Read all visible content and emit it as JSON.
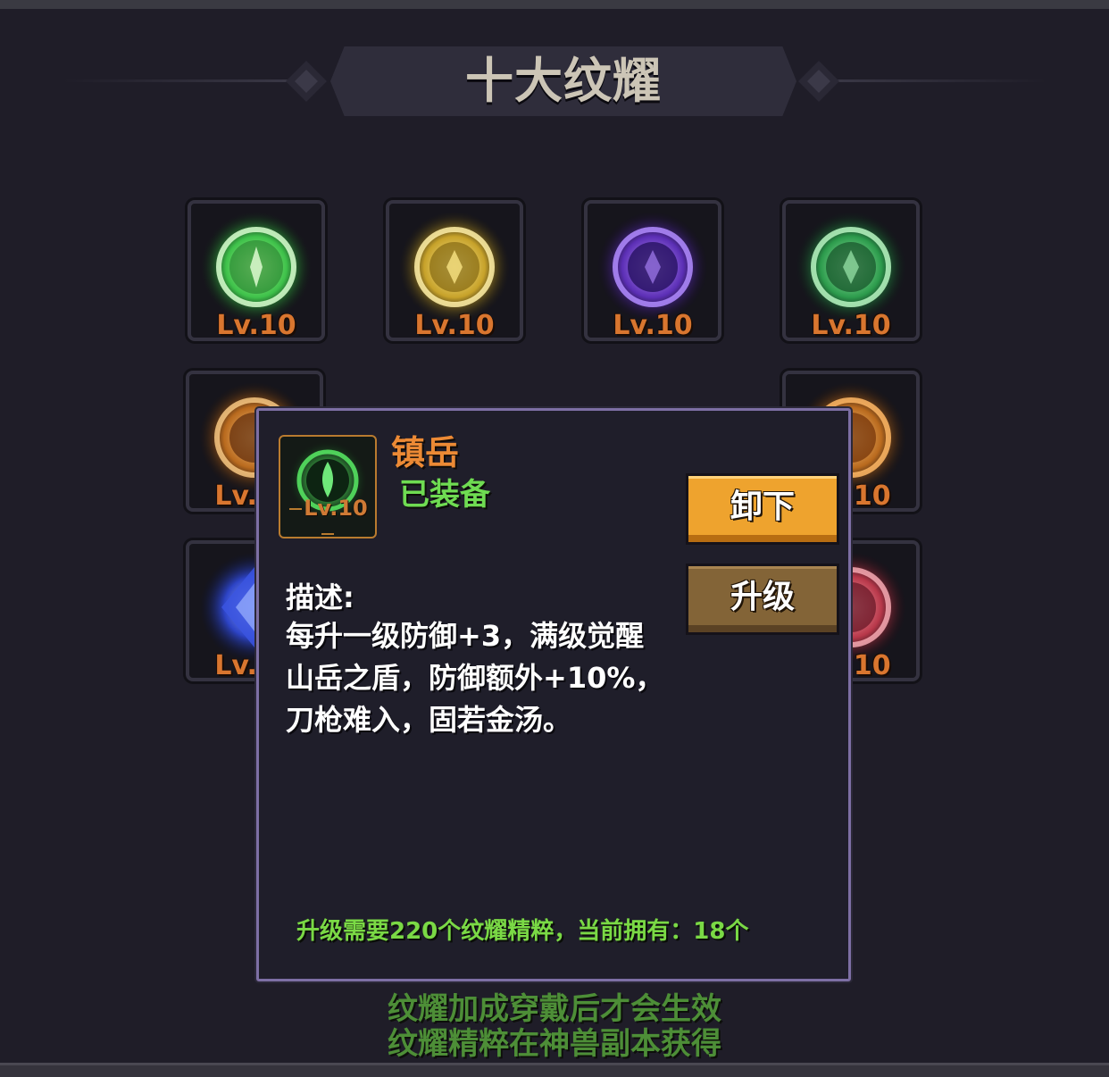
{
  "title": "十大纹耀",
  "slots": [
    {
      "level": "Lv.10",
      "icon": "green-leaf-ring-glyph-icon",
      "color": "#4fd15a"
    },
    {
      "level": "Lv.10",
      "icon": "gold-leaf-ring-glyph-icon",
      "color": "#e2c535"
    },
    {
      "level": "Lv.10",
      "icon": "purple-leaf-ring-glyph-icon",
      "color": "#7d43d8"
    },
    {
      "level": "Lv.10",
      "icon": "emerald-leaf-ring-glyph-icon",
      "color": "#3cc46a"
    },
    {
      "level": "Lv.10",
      "icon": "amber-flame-ring-glyph-icon",
      "color": "#e0892c"
    },
    {
      "level": "Lv.10",
      "icon": "orange-flame-ring-glyph-icon",
      "color": "#e8852a"
    },
    {
      "level": "Lv.10",
      "icon": "blue-crystal-glyph-icon",
      "color": "#3f5de0"
    },
    {
      "level": "Lv.10",
      "icon": "red-crystal-glyph-icon",
      "color": "#d24a5a"
    }
  ],
  "detail": {
    "name": "镇岳",
    "status": "已装备",
    "level": "Lv.10",
    "icon": "green-mountain-flame-glyph-icon",
    "unequip_label": "卸下",
    "upgrade_label": "升级",
    "description_label": "描述:",
    "description_lines": [
      "每升一级防御+3，满级觉醒",
      "山岳之盾，防御额外+10%，",
      "刀枪难入，固若金汤。"
    ],
    "upgrade_requirement": "升级需要220个纹耀精粹，当前拥有：18个"
  },
  "notes": [
    "纹耀加成穿戴后才会生效",
    "纹耀精粹在神兽副本获得"
  ]
}
